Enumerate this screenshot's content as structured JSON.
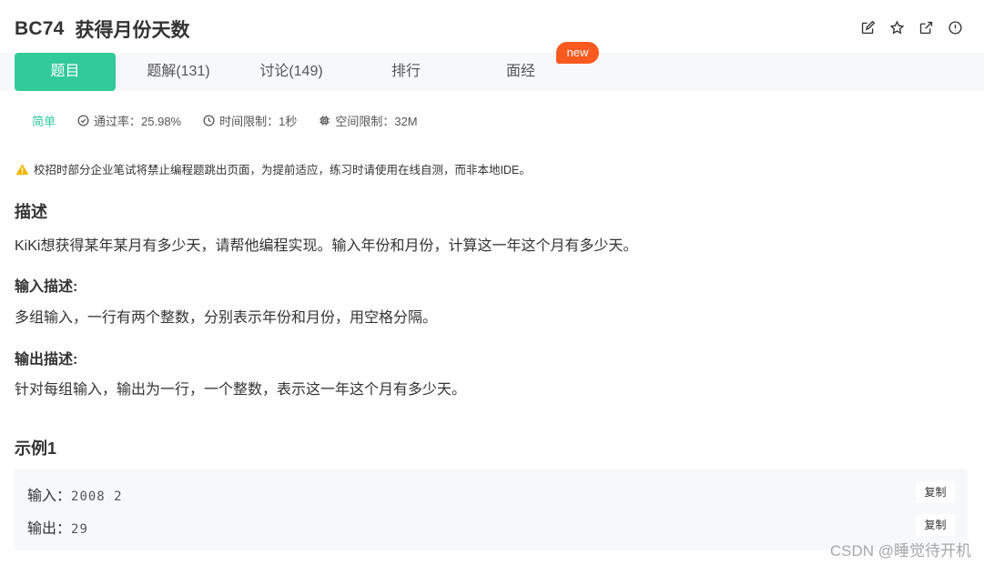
{
  "header": {
    "code": "BC74",
    "name": "获得月份天数"
  },
  "actions": [
    "edit-icon",
    "star-icon",
    "external-link-icon",
    "report-icon"
  ],
  "tabs": [
    {
      "label": "题目",
      "active": true
    },
    {
      "label": "题解(131)"
    },
    {
      "label": "讨论(149)"
    },
    {
      "label": "排行"
    },
    {
      "label": "面经"
    }
  ],
  "new_badge": "new",
  "meta": {
    "difficulty": "简单",
    "pass_rate": "通过率：25.98%",
    "time_limit": "时间限制：1秒",
    "space_limit": "空间限制：32M"
  },
  "notice": "校招时部分企业笔试将禁止编程题跳出页面，为提前适应，练习时请使用在线自测，而非本地IDE。",
  "description": {
    "title": "描述",
    "text": "KiKi想获得某年某月有多少天，请帮他编程实现。输入年份和月份，计算这一年这个月有多少天。"
  },
  "input_desc": {
    "title": "输入描述:",
    "text": "多组输入，一行有两个整数，分别表示年份和月份，用空格分隔。"
  },
  "output_desc": {
    "title": "输出描述:",
    "text": "针对每组输入，输出为一行，一个整数，表示这一年这个月有多少天。"
  },
  "example": {
    "title": "示例1",
    "input_label": "输入：",
    "input_value": "2008 2",
    "output_label": "输出：",
    "output_value": "29",
    "copy_label": "复制"
  },
  "watermark": "CSDN @睡觉待开机",
  "colors": {
    "accent": "#32ca99",
    "badge": "#fa5a1f",
    "warning": "#f5b400"
  }
}
